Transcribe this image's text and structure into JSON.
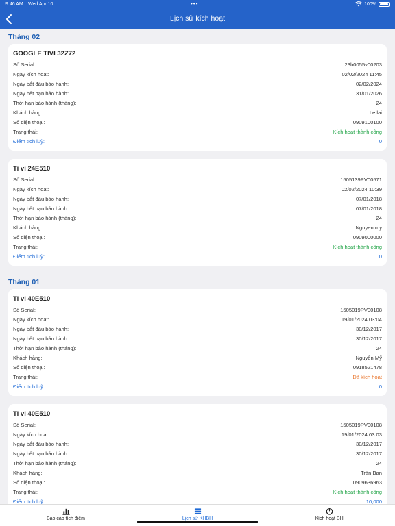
{
  "status": {
    "time": "9:46 AM",
    "date": "Wed Apr 10",
    "battery": "100%"
  },
  "header": {
    "title": "Lịch sử kích hoạt"
  },
  "labels": {
    "serial": "Số Serial:",
    "activated": "Ngày kích hoạt:",
    "warranty_start": "Ngày bắt đầu bảo hành:",
    "warranty_end": "Ngày hết hạn bảo hành:",
    "warranty_months": "Thời hạn bảo hành (tháng):",
    "customer": "Khách hàng:",
    "phone": "Số điện thoại:",
    "status": "Trạng thái:",
    "points": "Điểm tích luỹ:"
  },
  "months": [
    {
      "label": "Tháng 02",
      "cards": [
        {
          "name": "GOOGLE TIVI 32Z72",
          "serial": "23b0055v00203",
          "activated": "02/02/2024 11:45",
          "warranty_start": "02/02/2024",
          "warranty_end": "31/01/2026",
          "warranty_months": "24",
          "customer": "Le lai",
          "phone": "0909100100",
          "status": "Kích hoạt thành công",
          "status_type": "success",
          "points": "0"
        },
        {
          "name": "Ti vi 24E510",
          "serial": "1505139PV00571",
          "activated": "02/02/2024 10:39",
          "warranty_start": "07/01/2018",
          "warranty_end": "07/01/2018",
          "warranty_months": "24",
          "customer": "Nguyen my",
          "phone": "0909000000",
          "status": "Kích hoạt thành công",
          "status_type": "success",
          "points": "0"
        }
      ]
    },
    {
      "label": "Tháng 01",
      "cards": [
        {
          "name": "Ti vi 40E510",
          "serial": "1505019PV00108",
          "activated": "19/01/2024 03:04",
          "warranty_start": "30/12/2017",
          "warranty_end": "30/12/2017",
          "warranty_months": "24",
          "customer": "Nguyễn Mỹ",
          "phone": "0918521478",
          "status": "Đã kích hoạt",
          "status_type": "warning",
          "points": "0"
        },
        {
          "name": "Ti vi 40E510",
          "serial": "1505019PV00108",
          "activated": "19/01/2024 03:03",
          "warranty_start": "30/12/2017",
          "warranty_end": "30/12/2017",
          "warranty_months": "24",
          "customer": "Trần Ban",
          "phone": "0909636963",
          "status": "Kích hoạt thành công",
          "status_type": "success",
          "points": "10,000"
        }
      ]
    }
  ],
  "tabs": [
    {
      "label": "Báo cáo tích điểm",
      "icon": "bar-chart-icon",
      "active": false
    },
    {
      "label": "Lịch sử KHBH",
      "icon": "list-icon",
      "active": true
    },
    {
      "label": "Kích hoạt BH",
      "icon": "power-icon",
      "active": false
    }
  ],
  "colors": {
    "header": "#2563c9",
    "accent": "#1e6ad6",
    "success": "#22a447",
    "warning": "#e8742b"
  }
}
